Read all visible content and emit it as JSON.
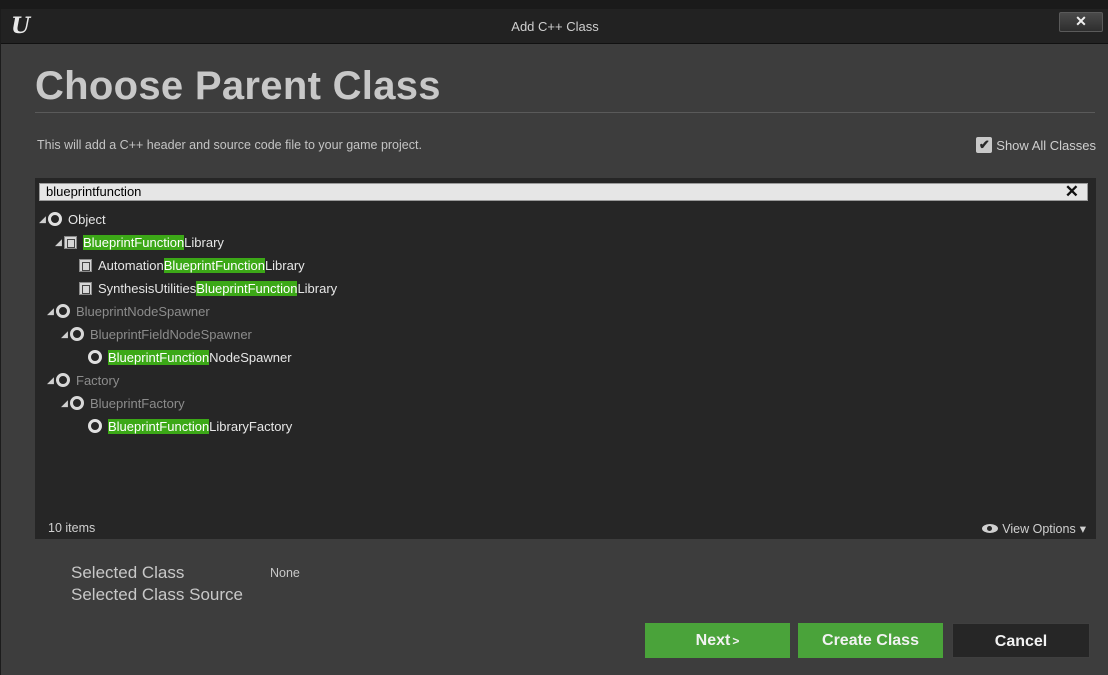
{
  "window": {
    "title": "Add C++ Class",
    "close_label": "✕",
    "logo": "U"
  },
  "page": {
    "title": "Choose Parent Class",
    "description": "This will add a C++ header and source code file to your game project.",
    "show_all_label": "Show All Classes",
    "show_all_checked": true
  },
  "search": {
    "value": "blueprintfunction",
    "clear_label": "✕"
  },
  "tree": [
    {
      "parts": [
        {
          "t": "Object",
          "h": false
        }
      ],
      "icon": "class-circle-icon",
      "dim": true
    },
    {
      "parts": [
        {
          "t": "BlueprintFunction",
          "h": true
        },
        {
          "t": "Library",
          "h": false
        }
      ],
      "icon": "blueprint-icon",
      "dim": false
    },
    {
      "parts": [
        {
          "t": "Automation",
          "h": false
        },
        {
          "t": "BlueprintFunction",
          "h": true
        },
        {
          "t": "Library",
          "h": false
        }
      ],
      "icon": "blueprint-icon",
      "dim": false
    },
    {
      "parts": [
        {
          "t": "SynthesisUtilities",
          "h": false
        },
        {
          "t": "BlueprintFunction",
          "h": true
        },
        {
          "t": "Library",
          "h": false
        }
      ],
      "icon": "blueprint-icon",
      "dim": false
    },
    {
      "parts": [
        {
          "t": "BlueprintNodeSpawner",
          "h": false
        }
      ],
      "icon": "class-circle-icon",
      "dim": true
    },
    {
      "parts": [
        {
          "t": "BlueprintFieldNodeSpawner",
          "h": false
        }
      ],
      "icon": "class-circle-icon",
      "dim": true
    },
    {
      "parts": [
        {
          "t": "BlueprintFunction",
          "h": true
        },
        {
          "t": "NodeSpawner",
          "h": false
        }
      ],
      "icon": "class-circle-icon",
      "dim": false
    },
    {
      "parts": [
        {
          "t": "Factory",
          "h": false
        }
      ],
      "icon": "class-circle-icon",
      "dim": true
    },
    {
      "parts": [
        {
          "t": "BlueprintFactory",
          "h": false
        }
      ],
      "icon": "class-circle-icon",
      "dim": true
    },
    {
      "parts": [
        {
          "t": "BlueprintFunction",
          "h": true
        },
        {
          "t": "LibraryFactory",
          "h": false
        }
      ],
      "icon": "class-circle-icon",
      "dim": false
    }
  ],
  "footer": {
    "items_count": "10 items",
    "view_options": "View Options"
  },
  "selection": {
    "class_label": "Selected Class",
    "class_value": "None",
    "source_label": "Selected Class Source"
  },
  "buttons": {
    "next": "Next",
    "next_arrow": ">",
    "create": "Create Class",
    "cancel": "Cancel"
  },
  "colors": {
    "highlight": "#3ca817",
    "primary_button": "#4aa33a"
  }
}
